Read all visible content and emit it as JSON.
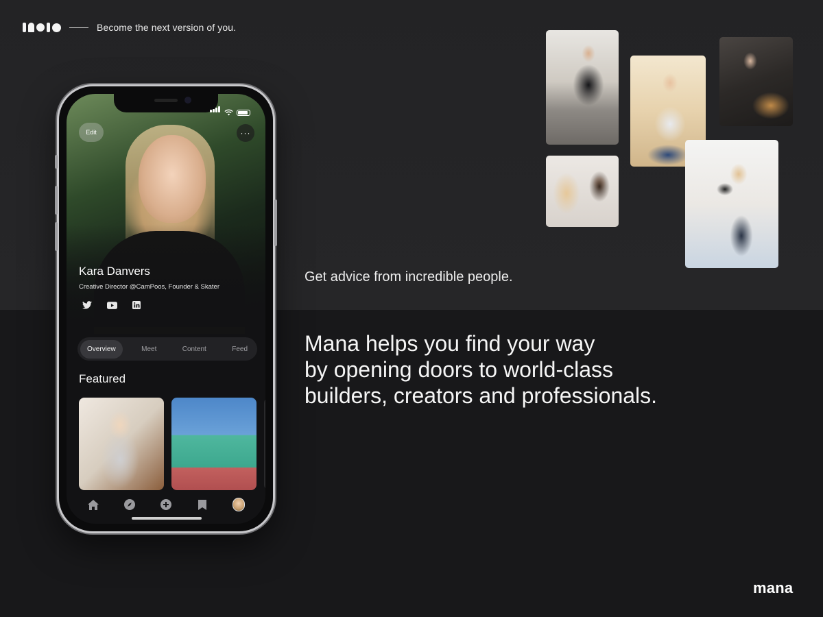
{
  "header": {
    "tagline": "Become the next version of you."
  },
  "phone": {
    "buttons": {
      "edit_label": "Edit",
      "more_label": "···"
    },
    "profile": {
      "name": "Kara Danvers",
      "role": "Creative Director @CamPoos, Founder & Skater",
      "socials": [
        "twitter-icon",
        "youtube-icon",
        "linkedin-icon"
      ]
    },
    "tabs": [
      {
        "label": "Overview",
        "active": true
      },
      {
        "label": "Meet"
      },
      {
        "label": "Content"
      },
      {
        "label": "Feed"
      }
    ],
    "featured_title": "Featured",
    "bottom_nav": [
      "home-icon",
      "compass-icon",
      "plus-icon",
      "bookmark-icon",
      "avatar"
    ]
  },
  "advice_text": "Get advice from incredible people.",
  "headline": {
    "line1": "Mana helps you find your way",
    "line2": "by opening doors to world-class",
    "line3": "builders, creators and professionals."
  },
  "footer_logo": "mana",
  "colors": {
    "background_top": "#242426",
    "background_bottom": "#18181a",
    "text": "#f5f5f5",
    "tab_active": "#38383c"
  }
}
